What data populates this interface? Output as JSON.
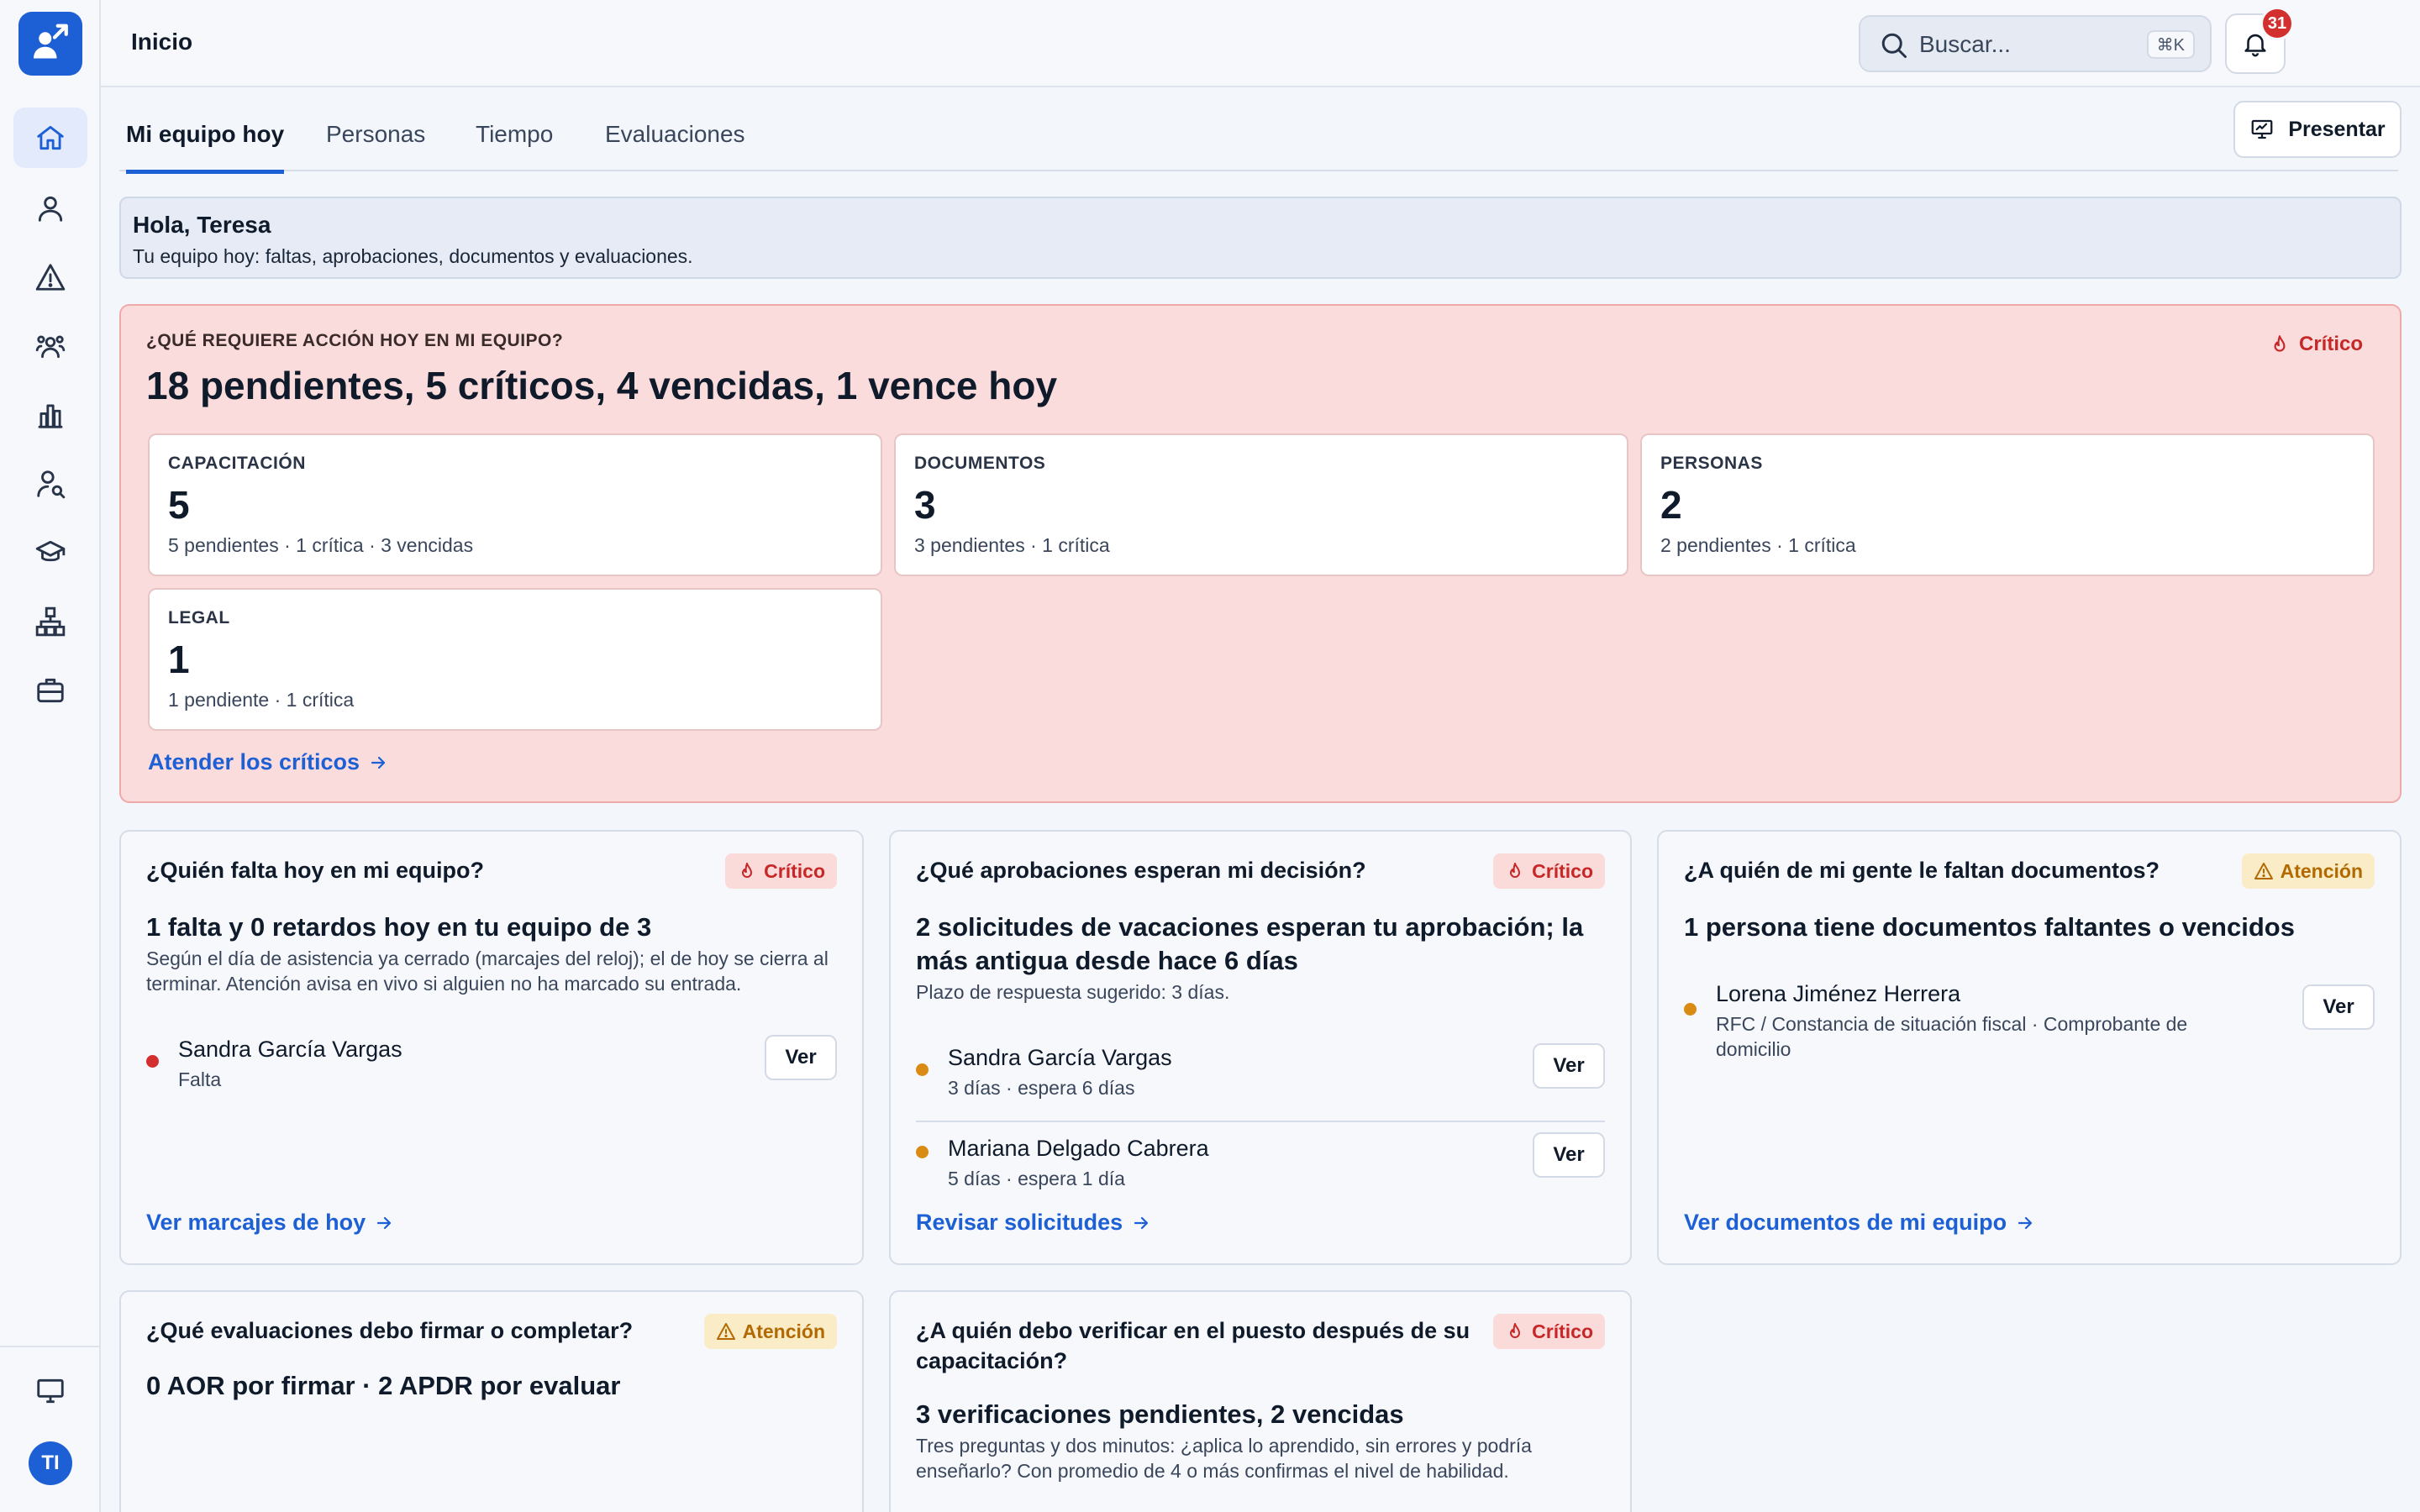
{
  "app": {
    "title": "Inicio",
    "avatar_initials": "TI",
    "notifications_count": "31"
  },
  "search": {
    "placeholder": "Buscar...",
    "shortcut": "⌘K"
  },
  "sidebar": {
    "items": [
      {
        "icon": "home-icon",
        "active": true
      },
      {
        "icon": "person-icon"
      },
      {
        "icon": "warning-icon"
      },
      {
        "icon": "team-icon"
      },
      {
        "icon": "bar-chart-icon"
      },
      {
        "icon": "user-search-icon"
      },
      {
        "icon": "graduation-cap-icon"
      },
      {
        "icon": "org-chart-icon"
      },
      {
        "icon": "briefcase-icon"
      }
    ],
    "bottom_icon": "monitor-icon"
  },
  "tabs": [
    {
      "label": "Mi equipo hoy",
      "active": true
    },
    {
      "label": "Personas"
    },
    {
      "label": "Tiempo"
    },
    {
      "label": "Evaluaciones"
    }
  ],
  "present_label": "Presentar",
  "greeting": {
    "title": "Hola, Teresa",
    "subtitle": "Tu equipo hoy: faltas, aprobaciones, documentos y evaluaciones."
  },
  "action_panel": {
    "eyebrow": "¿QUÉ REQUIERE ACCIÓN HOY EN MI EQUIPO?",
    "headline": "18 pendientes, 5 críticos, 4 vencidas, 1 vence hoy",
    "tag": "Crítico",
    "stats": [
      {
        "label": "CAPACITACIÓN",
        "value": "5",
        "sub": "5 pendientes · 1 crítica · 3 vencidas"
      },
      {
        "label": "DOCUMENTOS",
        "value": "3",
        "sub": "3 pendientes · 1 crítica"
      },
      {
        "label": "PERSONAS",
        "value": "2",
        "sub": "2 pendientes · 1 crítica"
      },
      {
        "label": "LEGAL",
        "value": "1",
        "sub": "1 pendiente · 1 crítica"
      }
    ],
    "link": "Atender los críticos"
  },
  "cards": {
    "absences": {
      "question": "¿Quién falta hoy en mi equipo?",
      "tag": "Crítico",
      "headline": "1 falta y 0 retardos hoy en tu equipo de 3",
      "text": "Según el día de asistencia ya cerrado (marcajes del reloj); el de hoy se cierra al terminar. Atención avisa en vivo si alguien no ha marcado su entrada.",
      "rows": [
        {
          "name": "Sandra García Vargas",
          "sub": "Falta",
          "button": "Ver"
        }
      ],
      "link": "Ver marcajes de hoy"
    },
    "approvals": {
      "question": "¿Qué aprobaciones esperan mi decisión?",
      "tag": "Crítico",
      "headline": "2 solicitudes de vacaciones esperan tu aprobación; la más antigua desde hace 6 días",
      "text": "Plazo de respuesta sugerido: 3 días.",
      "rows": [
        {
          "name": "Sandra García Vargas",
          "sub": "3 días · espera 6 días",
          "button": "Ver"
        },
        {
          "name": "Mariana Delgado Cabrera",
          "sub": "5 días · espera 1 día",
          "button": "Ver"
        }
      ],
      "link": "Revisar solicitudes"
    },
    "documents": {
      "question": "¿A quién de mi gente le faltan documentos?",
      "tag": "Atención",
      "headline": "1 persona tiene documentos faltantes o vencidos",
      "rows": [
        {
          "name": "Lorena Jiménez Herrera",
          "sub": "RFC / Constancia de situación fiscal · Comprobante de domicilio",
          "button": "Ver"
        }
      ],
      "link": "Ver documentos de mi equipo"
    },
    "evaluations": {
      "question": "¿Qué evaluaciones debo firmar o completar?",
      "tag": "Atención",
      "headline": "0 AOR por firmar · 2 APDR por evaluar"
    },
    "verifications": {
      "question": "¿A quién debo verificar en el puesto después de su capacitación?",
      "tag": "Crítico",
      "headline": "3 verificaciones pendientes, 2 vencidas",
      "text": "Tres preguntas y dos minutos: ¿aplica lo aprendido, sin errores y podría enseñarlo? Con promedio de 4 o más confirmas el nivel de habilidad."
    }
  }
}
